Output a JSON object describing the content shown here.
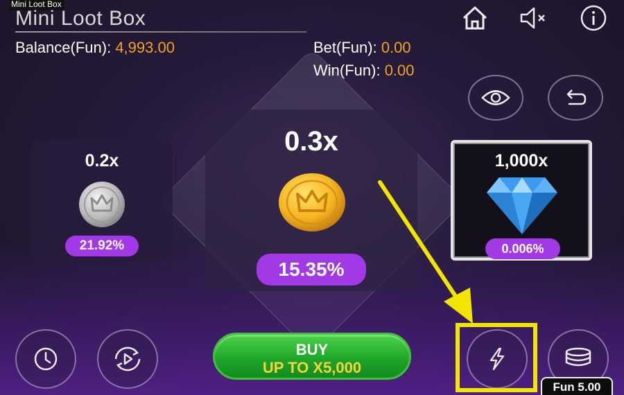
{
  "window": {
    "title": "Mini Loot Box"
  },
  "header": {
    "game_title": "Mini Loot Box",
    "balance_label": "Balance(Fun):",
    "balance_value": "4,993.00",
    "bet_label": "Bet(Fun):",
    "bet_value": "0.00",
    "win_label": "Win(Fun):",
    "win_value": "0.00"
  },
  "top_icons": [
    "home-icon",
    "sound-muted-icon",
    "info-icon"
  ],
  "side_icons": [
    "eye-icon",
    "undo-icon"
  ],
  "prizes": [
    {
      "multiplier": "0.2x",
      "chance": "21.92%",
      "item": "silver-coin"
    },
    {
      "multiplier": "0.3x",
      "chance": "15.35%",
      "item": "gold-coin"
    },
    {
      "multiplier": "1,000x",
      "chance": "0.006%",
      "item": "diamond"
    }
  ],
  "buy_button": {
    "line1": "BUY",
    "line2": "UP TO X5,000"
  },
  "bottom_icons": [
    "history-icon",
    "autoplay-icon",
    "turbo-icon",
    "coins-icon"
  ],
  "coin_value": "Fun 5.00",
  "colors": {
    "accent_orange": "#f2a51e",
    "percent_purple": "#a239e6",
    "buy_green": "#1fa72a",
    "highlight_yellow": "#f2e600"
  }
}
